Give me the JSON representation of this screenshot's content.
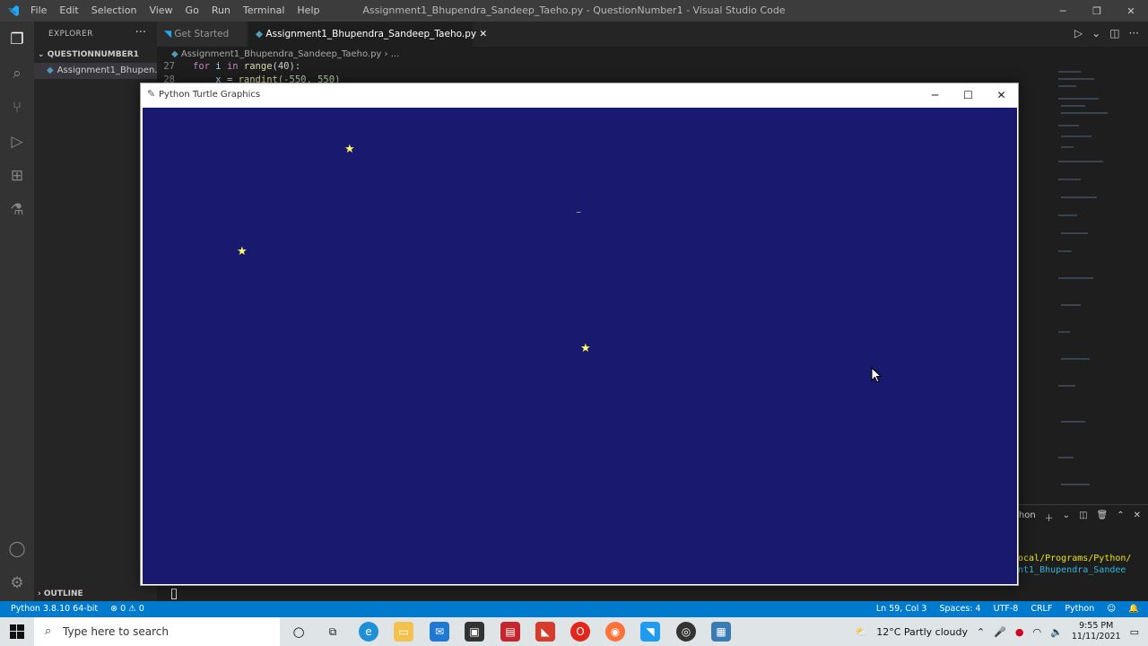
{
  "window": {
    "title": "Assignment1_Bhupendra_Sandeep_Taeho.py - QuestionNumber1 - Visual Studio Code",
    "menu": [
      "File",
      "Edit",
      "Selection",
      "View",
      "Go",
      "Run",
      "Terminal",
      "Help"
    ],
    "controls": {
      "minimize": "─",
      "restore": "❐",
      "close": "✕"
    }
  },
  "sidebar": {
    "header": "EXPLORER",
    "more": "···",
    "folder": "QUESTIONNUMBER1",
    "file": "Assignment1_Bhupen...",
    "outline": "OUTLINE"
  },
  "tabs": {
    "get_started": "Get Started",
    "active_file": "Assignment1_Bhupendra_Sandeep_Taeho.py",
    "close": "✕"
  },
  "breadcrumb": {
    "file": "Assignment1_Bhupendra_Sandeep_Taeho.py",
    "sep": "›",
    "more": "..."
  },
  "code": {
    "line27_num": "27",
    "line27_kw": "for",
    "line27_rest_a": " i ",
    "line27_in": "in",
    "line27_fn": " range",
    "line27_rest_b": "(40):",
    "line28_num": "28",
    "line28_var": "x",
    "line28_eq": " = ",
    "line28_fn": "randint",
    "line28_args": "(-550, 550)"
  },
  "terminal": {
    "label": "Python",
    "path1": "ocal/Programs/Python/",
    "path2": "nt1_Bhupendra_Sandee",
    "colors": {
      "path1": "#e5e510",
      "path2": "#29b8db"
    }
  },
  "statusbar": {
    "interpreter": "Python 3.8.10 64-bit",
    "errors": "⊗ 0 ⚠ 0",
    "position": "Ln 59, Col 3",
    "spaces": "Spaces: 4",
    "encoding": "UTF-8",
    "eol": "CRLF",
    "language": "Python"
  },
  "turtle_window": {
    "title": "Python Turtle Graphics",
    "controls": {
      "minimize": "─",
      "maximize": "☐",
      "close": "✕"
    },
    "background": "#191970",
    "star_color": "#ffff66",
    "stars": [
      {
        "glyph": "★"
      },
      {
        "glyph": "★"
      },
      {
        "glyph": "★"
      },
      {
        "glyph": "⁻"
      }
    ]
  },
  "taskbar": {
    "search_placeholder": "Type here to search",
    "weather": "12°C  Partly cloudy",
    "time": "9:55 PM",
    "date": "11/11/2021"
  },
  "colors": {
    "accent": "#007acc",
    "editor_bg": "#1e1e1e",
    "sidebar_bg": "#252526",
    "activity_bg": "#333333"
  }
}
